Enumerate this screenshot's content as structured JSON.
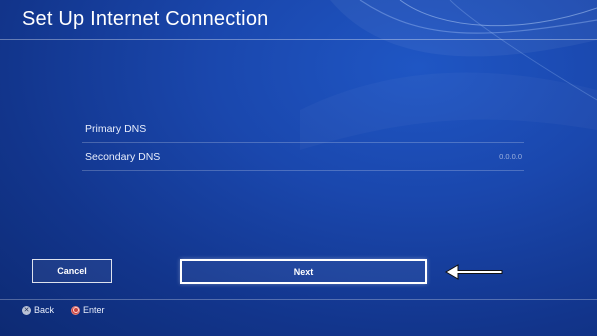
{
  "header": {
    "title": "Set Up Internet Connection"
  },
  "dns_settings": {
    "rows": [
      {
        "label": "Primary DNS",
        "value": ""
      },
      {
        "label": "Secondary DNS",
        "value": "0.0.0.0"
      }
    ]
  },
  "buttons": {
    "cancel_label": "Cancel",
    "next_label": "Next"
  },
  "footer": {
    "back_label": "Back",
    "enter_label": "Enter"
  },
  "icons": {
    "back": "cross-button-icon",
    "enter": "circle-button-icon",
    "annotation": "left-arrow-icon"
  },
  "colors": {
    "background": "#1a47ad",
    "text": "#ffffff",
    "enter_button": "#c8423e"
  }
}
